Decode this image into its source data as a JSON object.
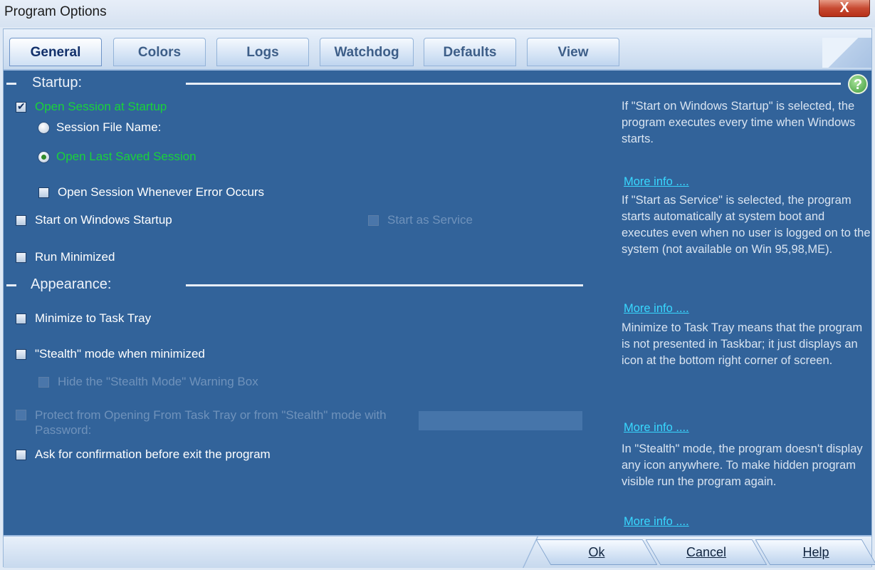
{
  "window": {
    "title": "Program Options",
    "close_label": "X"
  },
  "tabs": [
    "General",
    "Colors",
    "Logs",
    "Watchdog",
    "Defaults",
    "View"
  ],
  "sections": {
    "startup": "Startup:",
    "appearance": "Appearance:"
  },
  "help_icon": "?",
  "startup": {
    "open_session": {
      "label": "Open Session at Startup",
      "checked": true
    },
    "session_file": {
      "label": "Session File Name:",
      "selected": false
    },
    "open_last": {
      "label": "Open Last Saved Session",
      "selected": true
    },
    "open_on_error": {
      "label": "Open Session Whenever Error Occurs",
      "checked": false
    },
    "start_windows": {
      "label": "Start on Windows Startup",
      "checked": false
    },
    "start_service": {
      "label": "Start as Service",
      "checked": false,
      "enabled": false
    },
    "run_minimized": {
      "label": "Run Minimized",
      "checked": false
    }
  },
  "appearance": {
    "minimize_tray": {
      "label": "Minimize to Task Tray",
      "checked": false
    },
    "stealth_mode": {
      "label": "\"Stealth\" mode when minimized",
      "checked": false
    },
    "hide_stealth_warning": {
      "label": "Hide the \"Stealth Mode\" Warning Box",
      "checked": false,
      "enabled": false
    },
    "protect_password": {
      "label": "Protect from Opening From Task Tray or from \"Stealth\" mode with Password:",
      "checked": false,
      "enabled": false
    },
    "password_value": "",
    "ask_confirmation": {
      "label": "Ask for confirmation before exit the program",
      "checked": false
    }
  },
  "info_panel": {
    "startup_text": "If \"Start on Windows Startup\" is selected, the program executes every time when Windows starts.",
    "service_text": "If \"Start as Service\" is selected, the program starts automatically at system boot and executes even when no user is logged on to the system (not available on Win 95,98,ME).",
    "tray_text": "Minimize to Task Tray means that the program is not presented in Taskbar; it just displays an icon at the bottom right corner of screen.",
    "stealth_text": "In \"Stealth\" mode, the program doesn't display any icon anywhere. To make hidden program visible run the program again.",
    "more_info": "More info ...."
  },
  "buttons": {
    "ok": "Ok",
    "cancel": "Cancel",
    "help": "Help"
  },
  "colors": {
    "panel": "#32639a",
    "text": "#ffffff",
    "highlight": "#19d33a",
    "link": "#38d8ff"
  }
}
